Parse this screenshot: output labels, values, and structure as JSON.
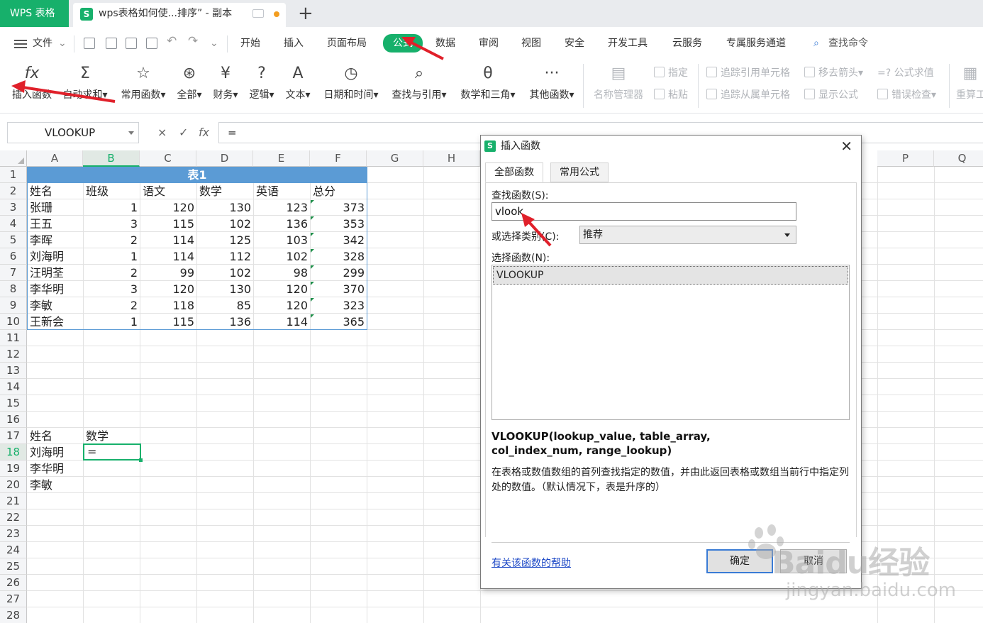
{
  "tabbar": {
    "app_tab": "WPS 表格",
    "doc_tab": "wps表格如何使...排序”  - 副本",
    "doc_icon": "S",
    "add_tab": "+"
  },
  "menubar": {
    "file": "文件",
    "items": [
      "开始",
      "插入",
      "页面布局",
      "公式",
      "数据",
      "审阅",
      "视图",
      "安全",
      "开发工具",
      "云服务",
      "专属服务通道"
    ],
    "active": "公式",
    "search": "查找命令"
  },
  "ribbon": {
    "buttons": [
      {
        "icon": "fx",
        "label": "插入函数"
      },
      {
        "icon": "Σ",
        "label": "自动求和▾"
      },
      {
        "icon": "☆",
        "label": "常用函数▾"
      },
      {
        "icon": "⊛",
        "label": "全部▾"
      },
      {
        "icon": "¥",
        "label": "财务▾"
      },
      {
        "icon": "?",
        "label": "逻辑▾"
      },
      {
        "icon": "A",
        "label": "文本▾"
      },
      {
        "icon": "◷",
        "label": "日期和时间▾"
      },
      {
        "icon": "⌕",
        "label": "查找与引用▾"
      },
      {
        "icon": "θ",
        "label": "数学和三角▾"
      },
      {
        "icon": "···",
        "label": "其他函数▾"
      },
      {
        "icon": "▤",
        "label": "名称管理器"
      }
    ],
    "small": {
      "designate": "指定",
      "paste": "粘贴",
      "trace_precedents": "追踪引用单元格",
      "trace_dependents": "追踪从属单元格",
      "remove_arrows": "移去箭头▾",
      "show_formula": "显示公式",
      "evaluate": "=? 公式求值",
      "error_check": "错误检查▾",
      "recalc": "重算工"
    }
  },
  "formula_bar": {
    "name_box": "VLOOKUP",
    "cancel": "×",
    "confirm": "✓",
    "fx": "fx",
    "content": "="
  },
  "sheet": {
    "columns": [
      "A",
      "B",
      "C",
      "D",
      "E",
      "F",
      "G",
      "H",
      "P",
      "Q"
    ],
    "selected_column": "B",
    "rows": [
      "1",
      "2",
      "3",
      "4",
      "5",
      "6",
      "7",
      "8",
      "9",
      "10",
      "11",
      "12",
      "13",
      "14",
      "15",
      "16",
      "17",
      "18",
      "19",
      "20",
      "21",
      "22",
      "23",
      "24",
      "25",
      "26",
      "27",
      "28"
    ],
    "selected_row": "18",
    "table_title": "表1",
    "headers": [
      "姓名",
      "班级",
      "语文",
      "数学",
      "英语",
      "总分"
    ],
    "records": [
      [
        "张珊",
        "1",
        "120",
        "130",
        "123",
        "373"
      ],
      [
        "王五",
        "3",
        "115",
        "102",
        "136",
        "353"
      ],
      [
        "李晖",
        "2",
        "114",
        "125",
        "103",
        "342"
      ],
      [
        "刘海明",
        "1",
        "114",
        "112",
        "102",
        "328"
      ],
      [
        "汪明荃",
        "2",
        "99",
        "102",
        "98",
        "299"
      ],
      [
        "李华明",
        "3",
        "120",
        "130",
        "120",
        "370"
      ],
      [
        "李敏",
        "2",
        "118",
        "85",
        "120",
        "323"
      ],
      [
        "王新会",
        "1",
        "115",
        "136",
        "114",
        "365"
      ]
    ],
    "lookup_header": [
      "姓名",
      "数学"
    ],
    "lookup_names": [
      "刘海明",
      "李华明",
      "李敏"
    ],
    "active_cell_value": "="
  },
  "dialog": {
    "title": "插入函数",
    "icon": "S",
    "close": "✕",
    "tabs": [
      "全部函数",
      "常用公式"
    ],
    "search_label": "查找函数(S):",
    "search_value": "vlook",
    "category_label": "或选择类别(C):",
    "category_value": "推荐",
    "list_label": "选择函数(N):",
    "functions": [
      "VLOOKUP"
    ],
    "signature": "VLOOKUP(lookup_value, table_array, col_index_num, range_lookup)",
    "description": "在表格或数值数组的首列查找指定的数值，并由此返回表格或数组当前行中指定列处的数值。（默认情况下，表是升序的）",
    "help_link": "有关该函数的帮助",
    "ok": "确定",
    "cancel": "取消"
  },
  "watermark": {
    "brand": "Baidu经验",
    "url": "jingyan.baidu.com"
  },
  "colors": {
    "accent_green": "#17b06b",
    "table_header_blue": "#5b9bd5",
    "annotation_red": "#e0202a",
    "link_blue": "#1a46c6"
  }
}
